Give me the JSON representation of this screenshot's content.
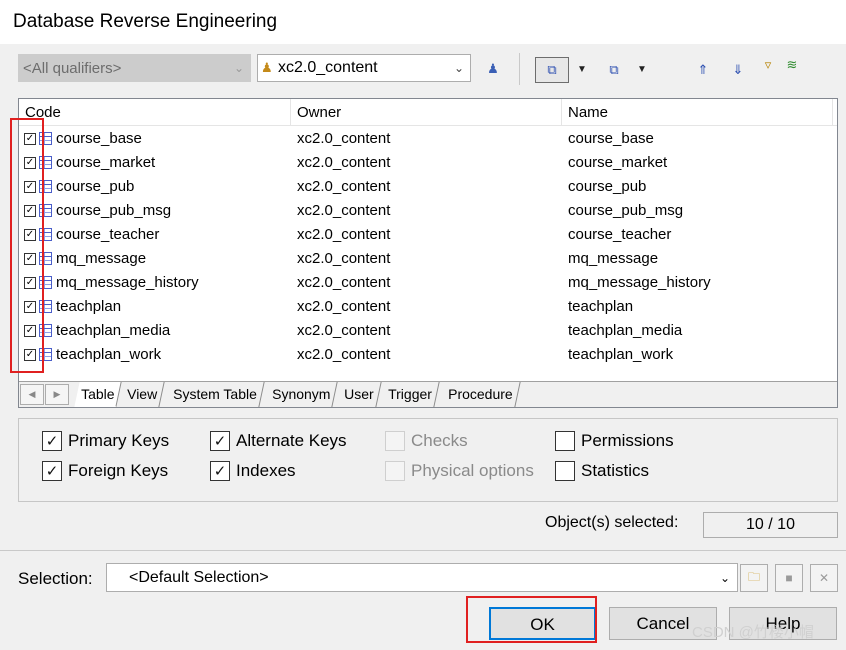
{
  "window": {
    "title": "Database Reverse Engineering"
  },
  "toolbar": {
    "qualifier_placeholder": "<All qualifiers>",
    "owner_value": "xc2.0_content"
  },
  "grid": {
    "columns": [
      "Code",
      "Owner",
      "Name"
    ],
    "rows": [
      {
        "code": "course_base",
        "owner": "xc2.0_content",
        "name": "course_base",
        "checked": true
      },
      {
        "code": "course_market",
        "owner": "xc2.0_content",
        "name": "course_market",
        "checked": true
      },
      {
        "code": "course_pub",
        "owner": "xc2.0_content",
        "name": "course_pub",
        "checked": true
      },
      {
        "code": "course_pub_msg",
        "owner": "xc2.0_content",
        "name": "course_pub_msg",
        "checked": true
      },
      {
        "code": "course_teacher",
        "owner": "xc2.0_content",
        "name": "course_teacher",
        "checked": true
      },
      {
        "code": "mq_message",
        "owner": "xc2.0_content",
        "name": "mq_message",
        "checked": true
      },
      {
        "code": "mq_message_history",
        "owner": "xc2.0_content",
        "name": "mq_message_history",
        "checked": true
      },
      {
        "code": "teachplan",
        "owner": "xc2.0_content",
        "name": "teachplan",
        "checked": true
      },
      {
        "code": "teachplan_media",
        "owner": "xc2.0_content",
        "name": "teachplan_media",
        "checked": true
      },
      {
        "code": "teachplan_work",
        "owner": "xc2.0_content",
        "name": "teachplan_work",
        "checked": true
      }
    ],
    "tabs": [
      "Table",
      "View",
      "System Table",
      "Synonym",
      "User",
      "Trigger",
      "Procedure"
    ],
    "active_tab": "Table"
  },
  "options": [
    {
      "label": "Primary Keys",
      "checked": true,
      "enabled": true
    },
    {
      "label": "Foreign Keys",
      "checked": true,
      "enabled": true
    },
    {
      "label": "Alternate Keys",
      "checked": true,
      "enabled": true
    },
    {
      "label": "Indexes",
      "checked": true,
      "enabled": true
    },
    {
      "label": "Checks",
      "checked": false,
      "enabled": false
    },
    {
      "label": "Physical options",
      "checked": false,
      "enabled": false
    },
    {
      "label": "Permissions",
      "checked": false,
      "enabled": true
    },
    {
      "label": "Statistics",
      "checked": false,
      "enabled": true
    }
  ],
  "status": {
    "objects_label": "Object(s) selected:",
    "objects_value": "10 / 10"
  },
  "selection": {
    "label": "Selection:",
    "value": "<Default Selection>"
  },
  "buttons": {
    "ok": "OK",
    "cancel": "Cancel",
    "help": "Help"
  },
  "watermark": "CSDN @竹楼小帽",
  "icons": {
    "owner": "user-icon",
    "connect": "user-connect-icon",
    "select_all": "select-all-icon",
    "deselect_all": "deselect-icon",
    "move_up": "move-up-icon",
    "move_down": "move-down-icon",
    "filter": "filter-icon",
    "filter_clear": "filter-clear-icon",
    "open": "folder-icon",
    "save": "save-icon",
    "delete": "delete-icon"
  },
  "colors": {
    "highlight_box": "#e02020",
    "default_button_border": "#0078d7"
  }
}
